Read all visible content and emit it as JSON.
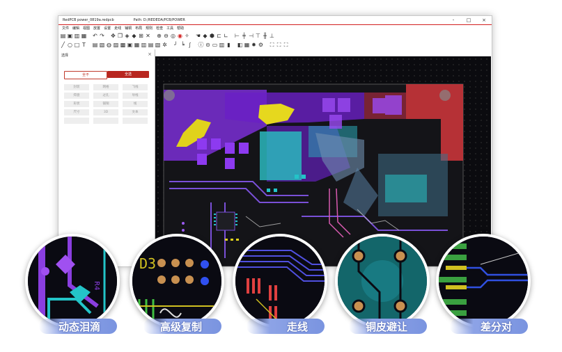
{
  "window": {
    "app_title": "RedPCB power_0819a.redpcb",
    "path": "Path: D:/REDEDA/PCB/POWER",
    "minimize": "-",
    "maximize": "□",
    "close": "×"
  },
  "menu": [
    "文件",
    "编辑",
    "视图",
    "放置",
    "设置",
    "走线",
    "铺铜",
    "布局",
    "规则",
    "检查",
    "工具",
    "帮助"
  ],
  "panel": {
    "title": "选择",
    "close": "×",
    "select_none": "全不",
    "select_all": "全选",
    "options": [
      [
        "封装",
        "网格",
        "飞线"
      ],
      [
        "焊盘",
        "过孔",
        "导线"
      ],
      [
        "形状",
        "铺铜",
        "线"
      ],
      [
        "尺寸",
        "3D",
        "文本"
      ],
      [
        "",
        "",
        ""
      ]
    ]
  },
  "features": [
    {
      "label": "动态泪滴"
    },
    {
      "label": "高级复制"
    },
    {
      "label": "走线"
    },
    {
      "label": "铜皮避让"
    },
    {
      "label": "差分对"
    }
  ],
  "colors": {
    "accent": "#b8261f",
    "canvas": "#0b0b0f",
    "purple": "#8a2be2",
    "cyan": "#23c4c8",
    "red": "#d43d3d",
    "yellow": "#e8d21e",
    "pill": "#8da3e6"
  },
  "circle_text": {
    "d3": "D3",
    "r4": "R4"
  }
}
